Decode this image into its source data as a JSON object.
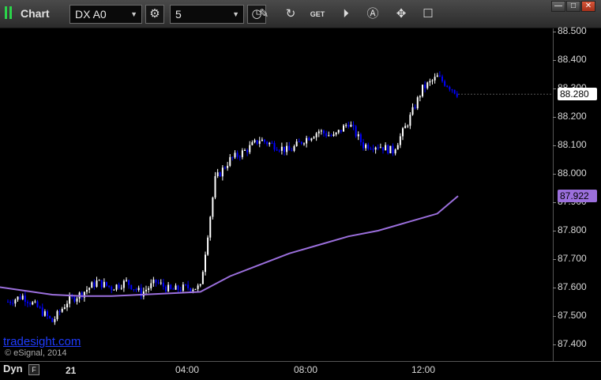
{
  "toolbar": {
    "title": "Chart",
    "symbol": "DX A0",
    "interval": "5",
    "get_label": "GET"
  },
  "window": {
    "minimize": "—",
    "maximize": "□",
    "close": "✕"
  },
  "price_axis": {
    "ticks": [
      "88.500",
      "88.400",
      "88.300",
      "88.200",
      "88.100",
      "88.000",
      "87.900",
      "87.800",
      "87.700",
      "87.600",
      "87.500",
      "87.400"
    ],
    "last_price": "88.280",
    "ma_value": "87.922"
  },
  "time_axis": {
    "day": "21",
    "labels": [
      "04:00",
      "08:00",
      "12:00"
    ]
  },
  "footer": {
    "mode": "Dyn",
    "watermark": "tradesight.com",
    "copyright": "© eSignal, 2014"
  },
  "colors": {
    "up": "#ffffff",
    "down": "#0000ff",
    "ma": "#9b6fdc",
    "background": "#000000",
    "last_price_tag": "#ffffff",
    "ma_tag": "#9b6fdc"
  },
  "icons": [
    "chart-grip-icon",
    "symbol-dropdown-icon",
    "gear-icon",
    "interval-dropdown-icon",
    "clock-icon",
    "pencil-icon",
    "refresh-icon",
    "get-icon",
    "play-icon",
    "alert-icon",
    "tools-icon",
    "comment-icon"
  ],
  "chart_data": {
    "type": "line",
    "symbol": "DX A0",
    "interval_minutes": 5,
    "y_range": [
      87.35,
      88.55
    ],
    "x_hours": [
      -0.5,
      15.2
    ],
    "close": [
      {
        "t": 0.0,
        "p": 87.55
      },
      {
        "t": 0.5,
        "p": 87.57
      },
      {
        "t": 1.0,
        "p": 87.53
      },
      {
        "t": 1.5,
        "p": 87.48
      },
      {
        "t": 2.0,
        "p": 87.55
      },
      {
        "t": 2.5,
        "p": 87.58
      },
      {
        "t": 3.0,
        "p": 87.62
      },
      {
        "t": 3.5,
        "p": 87.6
      },
      {
        "t": 4.0,
        "p": 87.62
      },
      {
        "t": 4.5,
        "p": 87.58
      },
      {
        "t": 5.0,
        "p": 87.62
      },
      {
        "t": 5.5,
        "p": 87.59
      },
      {
        "t": 6.0,
        "p": 87.6
      },
      {
        "t": 6.5,
        "p": 87.6
      },
      {
        "t": 7.0,
        "p": 87.98
      },
      {
        "t": 7.5,
        "p": 88.05
      },
      {
        "t": 8.0,
        "p": 88.08
      },
      {
        "t": 8.5,
        "p": 88.12
      },
      {
        "t": 9.0,
        "p": 88.1
      },
      {
        "t": 9.5,
        "p": 88.08
      },
      {
        "t": 10.0,
        "p": 88.12
      },
      {
        "t": 10.5,
        "p": 88.15
      },
      {
        "t": 11.0,
        "p": 88.13
      },
      {
        "t": 11.5,
        "p": 88.18
      },
      {
        "t": 12.0,
        "p": 88.1
      },
      {
        "t": 12.5,
        "p": 88.1
      },
      {
        "t": 13.0,
        "p": 88.08
      },
      {
        "t": 13.5,
        "p": 88.18
      },
      {
        "t": 14.0,
        "p": 88.3
      },
      {
        "t": 14.5,
        "p": 88.34
      },
      {
        "t": 15.0,
        "p": 88.3
      },
      {
        "t": 15.2,
        "p": 88.28
      }
    ],
    "moving_average": [
      {
        "t": -0.5,
        "p": 87.605
      },
      {
        "t": 0.5,
        "p": 87.59
      },
      {
        "t": 1.5,
        "p": 87.575
      },
      {
        "t": 2.5,
        "p": 87.57
      },
      {
        "t": 3.5,
        "p": 87.57
      },
      {
        "t": 4.5,
        "p": 87.575
      },
      {
        "t": 5.5,
        "p": 87.58
      },
      {
        "t": 6.5,
        "p": 87.585
      },
      {
        "t": 7.5,
        "p": 87.64
      },
      {
        "t": 8.5,
        "p": 87.68
      },
      {
        "t": 9.5,
        "p": 87.72
      },
      {
        "t": 10.5,
        "p": 87.75
      },
      {
        "t": 11.5,
        "p": 87.78
      },
      {
        "t": 12.5,
        "p": 87.8
      },
      {
        "t": 13.5,
        "p": 87.83
      },
      {
        "t": 14.5,
        "p": 87.86
      },
      {
        "t": 15.2,
        "p": 87.922
      }
    ]
  }
}
